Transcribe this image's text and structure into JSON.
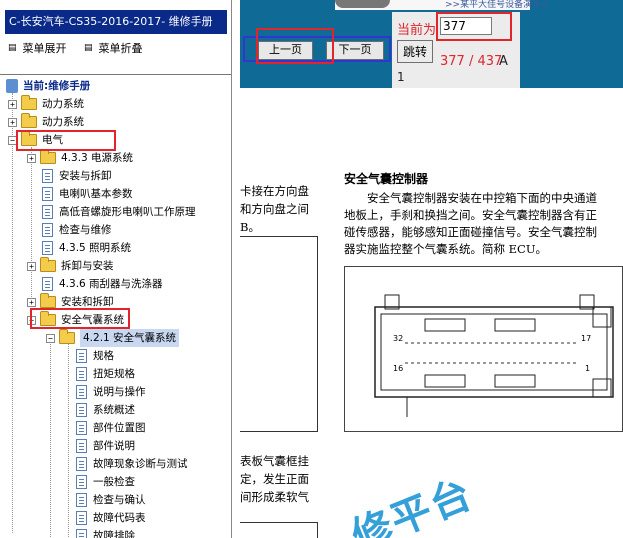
{
  "sidebar": {
    "title": "C-长安汽车-CS35-2016-2017- 维修手册",
    "expand_all": "菜单展开",
    "collapse_all": "菜单折叠",
    "current_label": "当前:维修手册",
    "nodes": [
      {
        "label": "动力系统",
        "kind": "folder"
      },
      {
        "label": "动力系统",
        "kind": "folder"
      },
      {
        "label": "电气",
        "kind": "folder"
      },
      {
        "label": "4.3.3 电源系统",
        "kind": "folder"
      },
      {
        "label": "安装与拆卸",
        "kind": "doc"
      },
      {
        "label": "电喇叭基本参数",
        "kind": "doc"
      },
      {
        "label": "高低音螺旋形电喇叭工作原理",
        "kind": "doc"
      },
      {
        "label": "检查与维修",
        "kind": "doc"
      },
      {
        "label": "4.3.5 照明系统",
        "kind": "doc"
      },
      {
        "label": "拆卸与安装",
        "kind": "folder"
      },
      {
        "label": "4.3.6 雨刮器与洗涤器",
        "kind": "doc"
      },
      {
        "label": "安装和拆卸",
        "kind": "folder"
      },
      {
        "label": "安全气囊系统",
        "kind": "folder"
      },
      {
        "label": "4.2.1 安全气囊系统",
        "kind": "folder"
      },
      {
        "label": "规格",
        "kind": "doc"
      },
      {
        "label": "扭矩规格",
        "kind": "doc"
      },
      {
        "label": "说明与操作",
        "kind": "doc"
      },
      {
        "label": "系统概述",
        "kind": "doc"
      },
      {
        "label": "部件位置图",
        "kind": "doc"
      },
      {
        "label": "部件说明",
        "kind": "doc"
      },
      {
        "label": "故障现象诊断与测试",
        "kind": "doc"
      },
      {
        "label": "一般检查",
        "kind": "doc"
      },
      {
        "label": "检查与确认",
        "kind": "doc"
      },
      {
        "label": "故障代码表",
        "kind": "doc"
      },
      {
        "label": "故障排除",
        "kind": "doc"
      }
    ]
  },
  "viewer": {
    "top_banner_text": ">>某平大佳号设备演示<",
    "prev_page": "上一页",
    "next_page": "下一页",
    "current_page_label": "当前为",
    "page_input_value": "377",
    "jump_button": "跳转",
    "page_count": "377 / 437",
    "page_suffix": "A",
    "zoom_indicator": "1"
  },
  "document": {
    "left_fragment_lines": [
      "卡接在方向盘",
      "和方向盘之间",
      "B。"
    ],
    "left_fragment_lines_2": [
      "表板气囊框挂",
      "定，发生正面",
      "间形成柔软气"
    ],
    "heading": "安全气囊控制器",
    "paragraph_lines": [
      "安全气囊控制器安装在中控箱下面的中央通道",
      "地板上，手刹和换挡之间。安全气囊控制器含有正",
      "碰传感器，能够感知正面碰撞信号。安全气囊控制",
      "器实施监控整个气囊系统。简称 ECU。"
    ],
    "connector_pins": [
      "32",
      "17",
      "16",
      "1"
    ],
    "watermark": "修平台"
  },
  "colors": {
    "title_bar": "#0a2a8a",
    "highlight_red": "#e0262b",
    "banner_blue": "#0f6a96"
  }
}
